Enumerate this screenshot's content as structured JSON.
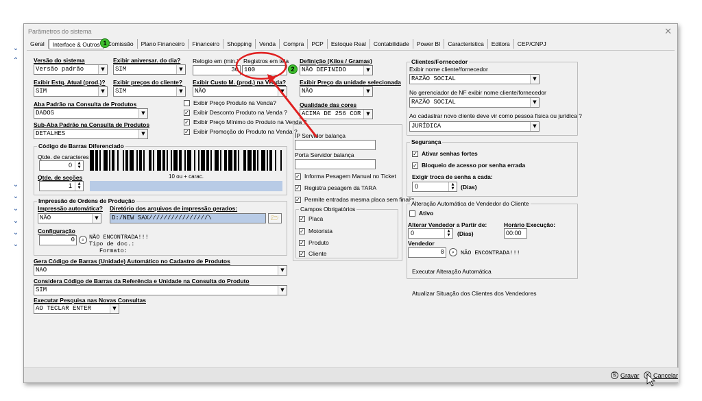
{
  "window": {
    "title": "Parâmetros do sistema",
    "close": "✕"
  },
  "tabs": [
    {
      "label": "Geral"
    },
    {
      "label": "Interface & Outros",
      "active": true
    },
    {
      "label": "Comissão"
    },
    {
      "label": "Plano Financeiro"
    },
    {
      "label": "Financeiro"
    },
    {
      "label": "Shopping"
    },
    {
      "label": "Venda"
    },
    {
      "label": "Compra"
    },
    {
      "label": "PCP"
    },
    {
      "label": "Estoque Real"
    },
    {
      "label": "Contabilidade"
    },
    {
      "label": "Power BI"
    },
    {
      "label": "Característica"
    },
    {
      "label": "Editora"
    },
    {
      "label": "CEP/CNPJ"
    }
  ],
  "col1": {
    "versao_label": "Versão do sistema",
    "versao_value": "Versão padrão",
    "aniversar_label": "Exibir aniversar. do dia?",
    "aniversar_value": "SIM",
    "estq_label": "Exibir Estq. Atual (prod.)?",
    "estq_value": "SIM",
    "precos_label": "Exibir preços do cliente?",
    "precos_value": "SIM",
    "aba_label": "Aba Padrão na Consulta de Produtos",
    "aba_value": "DADOS",
    "subaba_label": "Sub-Aba Padrão na Consulta de Produtos",
    "subaba_value": "DETALHES"
  },
  "barcode": {
    "group_title": "Código de Barras Diferenciado",
    "qtde_car_label": "Qtde. de caracteres",
    "qtde_car_value": "0",
    "qtde_sec_label": "Qtde. de seções",
    "qtde_sec_value": "1",
    "caption": "10 ou + carac."
  },
  "producao": {
    "group_title": "Impressão de Ordens de Produção",
    "auto_label": "Impressão automática?",
    "auto_value": "NÃO",
    "dir_label": "Diretório dos arquivos de impressão gerados:",
    "dir_value": "D:/NEW SAX////////////////\\",
    "config_label": "Configuração",
    "config_value": "0",
    "nao_encontrada": "NÃO ENCONTRADA!!!",
    "tipo_doc": "Tipo de doc.:",
    "formato": "Formato:"
  },
  "gera_cod": {
    "label": "Gera Código de Barras (Unidade) Automático no Cadastro de Produtos",
    "value": "NAO"
  },
  "considera": {
    "label": "Considera Código de Barras da Referência e Unidade na Consulta do Produto",
    "value": "SIM"
  },
  "pesquisa": {
    "label": "Executar Pesquisa nas Novas Consultas",
    "value": "AO TECLAR ENTER"
  },
  "col2": {
    "relogio_label": "Relogio em (min.)",
    "relogio_value": "30",
    "registros_label": "Registros em tela",
    "registros_value": "100",
    "custo_label": "Exibir Custo M. (prod.) na Venda?",
    "custo_value": "NÃO",
    "chk_preco_produto": "Exibir Preço Produto na Venda?",
    "chk_desconto": "Exibir Desconto Produto na Venda ?",
    "chk_preco_minimo": "Exibir Preço Mínimo do Produto na Venda ?",
    "chk_promocao": "Exibir Promoção do Produto na Venda ?"
  },
  "col3": {
    "definicao_label": "Definição (Kilos / Gramas)",
    "definicao_value": "NÃO DEFINIDO",
    "preco_unidade_label": "Exibir Preço da unidade selecionada",
    "preco_unidade_value": "NÃO",
    "qualidade_label": "Qualidade das cores",
    "qualidade_value": "ACIMA DE 256 COR",
    "ip_label": "IP Servidor balança",
    "porta_label": "Porta Servidor balança",
    "chk_informa": "Informa Pesagem Manual no Ticket",
    "chk_registra": "Registra pesagem da TARA",
    "chk_permite": "Permite entradas mesma placa sem finaliz",
    "campos_title": "Campos Obrigatórios",
    "campos": [
      "Placa",
      "Motorista",
      "Produto",
      "Cliente"
    ]
  },
  "clientes": {
    "group_title": "Clientes/Fornecedor",
    "exibir_nome_label": "Exibir nome cliente/fornecedor",
    "exibir_nome_value": "RAZÃO SOCIAL",
    "nf_label": "No gerenciador de NF exibir nome cliente/fornecedor",
    "nf_value": "RAZÃO SOCIAL",
    "cadastrar_label": "Ao cadastrar novo cliente deve vir como pessoa física ou jurídica ?",
    "cadastrar_value": "JURÍDICA"
  },
  "seguranca": {
    "group_title": "Segurança",
    "chk_senhas": "Ativar senhas fortes",
    "chk_bloqueio": "Bloqueio de acesso por senha errada",
    "troca_label": "Exigir troca de senha a cada:",
    "troca_value": "0",
    "dias": "(Dias)"
  },
  "alteracao": {
    "group_title": "Alteração Automática de Vendedor do Cliente",
    "ativo": "Ativo",
    "alterar_label": "Alterar Vendedor a Partir de:",
    "alterar_value": "0",
    "dias": "(Dias)",
    "horario_label": "Horário Execução:",
    "horario_value": "00:00",
    "vendedor_label": "Vendedor",
    "vendedor_value": "0",
    "nao_encontrada": "NÃO ENCONTRADA!!!",
    "executar": "Executar Alteração Automática",
    "atualizar": "Atualizar Situação dos Clientes dos Vendedores"
  },
  "footer": {
    "gravar": "Gravar",
    "cancelar": "Cancelar"
  },
  "annotations": {
    "badge1": "1",
    "badge2": "2",
    "accent_red": "#e02020",
    "accent_green": "#3fbf2f"
  }
}
